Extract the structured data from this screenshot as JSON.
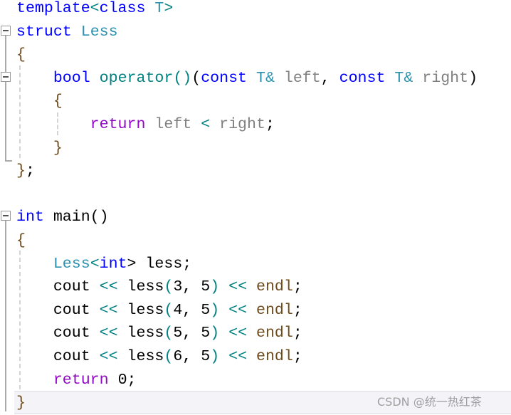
{
  "editor": {
    "lines": [
      [
        [
          "template",
          "kw"
        ],
        [
          "<",
          "op"
        ],
        [
          "class",
          "kw"
        ],
        [
          " "
        ],
        [
          "T",
          "ty"
        ],
        [
          ">",
          "op"
        ]
      ],
      [
        [
          "struct",
          "kw"
        ],
        [
          " "
        ],
        [
          "Less",
          "ty"
        ]
      ],
      [
        [
          "{",
          "br"
        ]
      ],
      [
        [
          "    "
        ],
        [
          "bool",
          "kw"
        ],
        [
          " "
        ],
        [
          "operator()",
          "fn"
        ],
        [
          "(",
          "pl"
        ],
        [
          "const",
          "kw"
        ],
        [
          " "
        ],
        [
          "T&",
          "ty"
        ],
        [
          " "
        ],
        [
          "left",
          "pm"
        ],
        [
          ", ",
          "pl"
        ],
        [
          "const",
          "kw"
        ],
        [
          " "
        ],
        [
          "T&",
          "ty"
        ],
        [
          " "
        ],
        [
          "right",
          "pm"
        ],
        [
          ")",
          "pl"
        ]
      ],
      [
        [
          "    "
        ],
        [
          "{",
          "br"
        ]
      ],
      [
        [
          "        "
        ],
        [
          "return",
          "rt"
        ],
        [
          " "
        ],
        [
          "left",
          "pm"
        ],
        [
          " < ",
          "op"
        ],
        [
          "right",
          "pm"
        ],
        [
          ";",
          "pl"
        ]
      ],
      [
        [
          "    "
        ],
        [
          "}",
          "br"
        ]
      ],
      [
        [
          "}",
          "br"
        ],
        [
          ";",
          "pl"
        ]
      ],
      [
        [
          ""
        ]
      ],
      [
        [
          "int",
          "kw"
        ],
        [
          " main()",
          "pl"
        ]
      ],
      [
        [
          "{",
          "br"
        ]
      ],
      [
        [
          "    "
        ],
        [
          "Less",
          "ty"
        ],
        [
          "<",
          "op"
        ],
        [
          "int",
          "kw"
        ],
        [
          "> less;",
          "pl"
        ]
      ],
      [
        [
          "    "
        ],
        [
          "cout",
          "pl"
        ],
        [
          " << ",
          "op"
        ],
        [
          "less",
          "pl"
        ],
        [
          "(",
          "op"
        ],
        [
          "3, 5",
          "pl"
        ],
        [
          ")",
          "op"
        ],
        [
          " << ",
          "op"
        ],
        [
          "endl",
          "en"
        ],
        [
          ";",
          "pl"
        ]
      ],
      [
        [
          "    "
        ],
        [
          "cout",
          "pl"
        ],
        [
          " << ",
          "op"
        ],
        [
          "less",
          "pl"
        ],
        [
          "(",
          "op"
        ],
        [
          "4, 5",
          "pl"
        ],
        [
          ")",
          "op"
        ],
        [
          " << ",
          "op"
        ],
        [
          "endl",
          "en"
        ],
        [
          ";",
          "pl"
        ]
      ],
      [
        [
          "    "
        ],
        [
          "cout",
          "pl"
        ],
        [
          " << ",
          "op"
        ],
        [
          "less",
          "pl"
        ],
        [
          "(",
          "op"
        ],
        [
          "5, 5",
          "pl"
        ],
        [
          ")",
          "op"
        ],
        [
          " << ",
          "op"
        ],
        [
          "endl",
          "en"
        ],
        [
          ";",
          "pl"
        ]
      ],
      [
        [
          "    "
        ],
        [
          "cout",
          "pl"
        ],
        [
          " << ",
          "op"
        ],
        [
          "less",
          "pl"
        ],
        [
          "(",
          "op"
        ],
        [
          "6, 5",
          "pl"
        ],
        [
          ")",
          "op"
        ],
        [
          " << ",
          "op"
        ],
        [
          "endl",
          "en"
        ],
        [
          ";",
          "pl"
        ]
      ],
      [
        [
          "    "
        ],
        [
          "return",
          "rt"
        ],
        [
          " 0;",
          "pl"
        ]
      ],
      [
        [
          "}",
          "br"
        ]
      ]
    ]
  },
  "watermark": "CSDN @统一热红茶"
}
